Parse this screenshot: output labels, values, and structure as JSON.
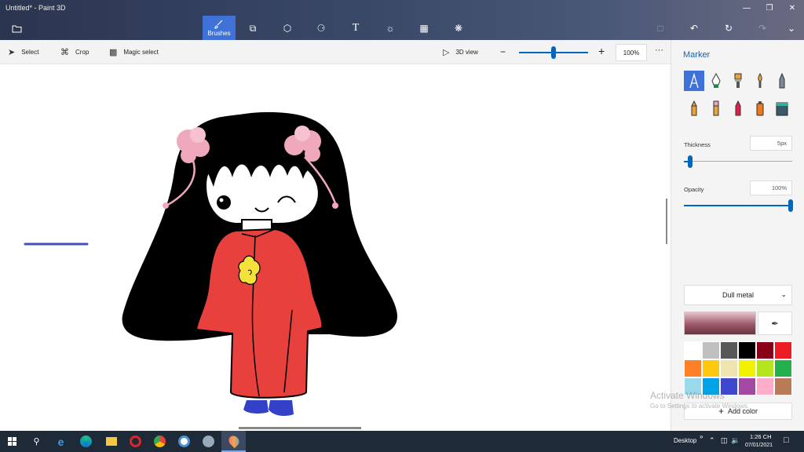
{
  "window": {
    "title": "Untitled* - Paint 3D"
  },
  "toolbar": {
    "active_tab_label": "Brushes",
    "tabs": [
      "menu-folder",
      "brushes",
      "2d-shapes",
      "3d-shapes",
      "stickers",
      "text",
      "effects",
      "canvas",
      "3d-library"
    ],
    "accent": "#3f72d8"
  },
  "subbar": {
    "select_label": "Select",
    "crop_label": "Crop",
    "magic_select_label": "Magic select",
    "view3d_label": "3D view",
    "zoom_value": "100%",
    "more": "···"
  },
  "panel": {
    "title": "Marker",
    "thickness_label": "Thickness",
    "thickness_value": "5px",
    "opacity_label": "Opacity",
    "opacity_value": "100%",
    "finish_value": "Dull metal",
    "add_color_label": "Add color",
    "palette": [
      "#ffffff",
      "#c0c0c0",
      "#585858",
      "#000000",
      "#880015",
      "#ed1c24",
      "#ff7f27",
      "#ffc90e",
      "#efe4b0",
      "#f2f200",
      "#b5e61d",
      "#22b14c",
      "#99d9ea",
      "#00a2e8",
      "#3f48cc",
      "#a349a4",
      "#ffaec9",
      "#b97a57"
    ]
  },
  "watermark": {
    "line1": "Activate Windows",
    "line2": "Go to Settings to activate Windows."
  },
  "taskbar": {
    "desktop_label": "Desktop",
    "time": "1:26 CH",
    "date": "07/01/2021",
    "chevron": "»"
  }
}
